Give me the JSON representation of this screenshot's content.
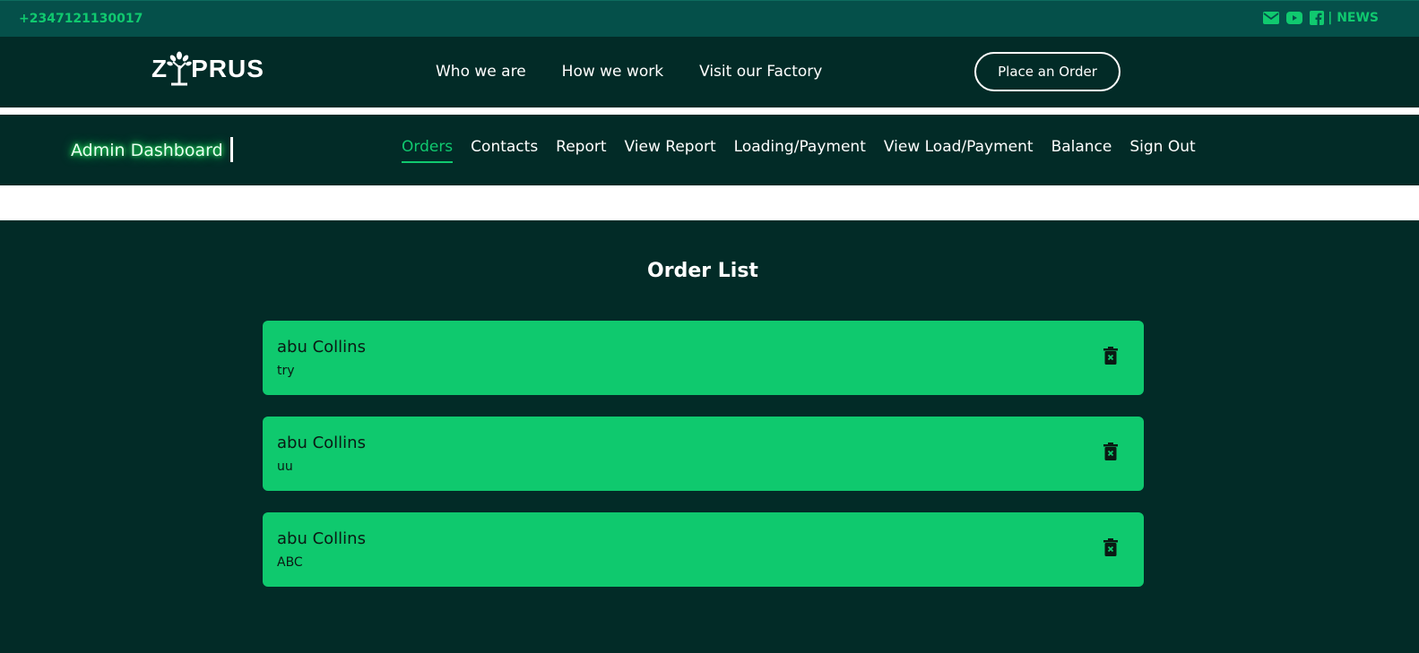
{
  "topbar": {
    "phone": "+2347121130017",
    "icons": [
      "envelope-icon",
      "youtube-icon",
      "facebook-icon"
    ],
    "news_label": "| NEWS"
  },
  "navbar": {
    "logo_left": "Z",
    "logo_right": "PRUS",
    "links": [
      "Who we are",
      "How we work",
      "Visit our Factory"
    ],
    "order_button": "Place an Order"
  },
  "admin": {
    "title": "Admin Dashboard",
    "links": [
      "Orders",
      "Contacts",
      "Report",
      "View Report",
      "Loading/Payment",
      "View Load/Payment",
      "Balance",
      "Sign Out"
    ],
    "active": "Orders"
  },
  "orders": {
    "title": "Order List",
    "items": [
      {
        "name": "abu Collins",
        "note": "try"
      },
      {
        "name": "abu Collins",
        "note": "uu"
      },
      {
        "name": "abu Collins",
        "note": "ABC"
      }
    ]
  },
  "colors": {
    "accent": "#10c96f",
    "dark_bg": "#022b27",
    "topbar_bg": "#05504a",
    "card_bg": "#0fc96e"
  }
}
